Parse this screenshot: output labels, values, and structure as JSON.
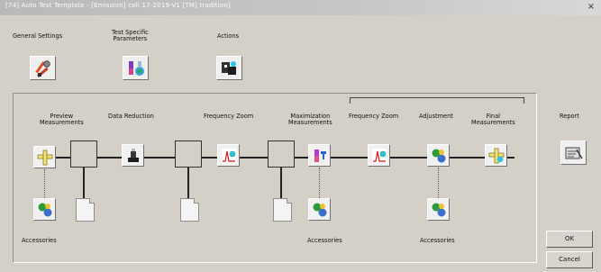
{
  "window": {
    "title": "[74] Auto Test Template - [Emission] coll 17-2019-V1 [TM] tradition]",
    "close_glyph": "×"
  },
  "toolbar": {
    "general_settings_label": "General Settings",
    "test_specific_parameters_label": "Test Specific\nParameters",
    "actions_label": "Actions"
  },
  "flow": {
    "steps": {
      "preview": "Preview\nMeasurements",
      "data_reduction": "Data Reduction",
      "frequency_zoom_1": "Frequency Zoom",
      "maximization": "Maximization\nMeasurements",
      "frequency_zoom_2": "Frequency Zoom",
      "adjustment": "Adjustment",
      "final": "Final\nMeasurements"
    },
    "accessories": {
      "left": "Accessories",
      "middle": "Accessories",
      "right": "Accessories"
    }
  },
  "report_label": "Report",
  "buttons": {
    "ok": "OK",
    "cancel": "Cancel"
  },
  "icons": {
    "general_settings": "tools-icon",
    "test_specific": "lab-flask-icon",
    "actions": "actions-icon",
    "preview": "preview-icon",
    "data_reduction": "data-reduction-icon",
    "frequency_zoom": "frequency-zoom-icon",
    "maximization": "maximization-icon",
    "adjustment": "adjustment-icon",
    "final": "final-measurement-icon",
    "accessories": "accessories-icon",
    "report": "report-icon",
    "document": "document-icon"
  }
}
